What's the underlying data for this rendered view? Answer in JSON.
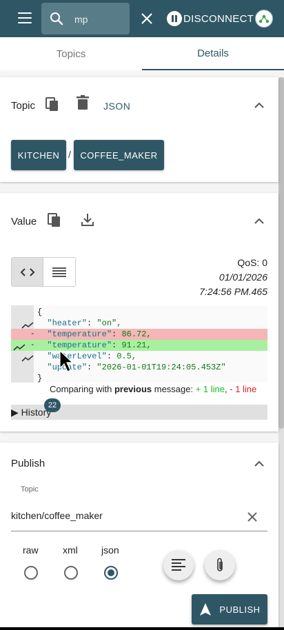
{
  "search": {
    "value": "mp"
  },
  "connection": {
    "label": "DISCONNECT"
  },
  "tabs": [
    {
      "label": "Topics"
    },
    {
      "label": "Details"
    }
  ],
  "topic_section": {
    "title": "Topic",
    "format": "JSON",
    "path": [
      "KITCHEN",
      "COFFEE_MAKER"
    ],
    "separator": "/"
  },
  "value_section": {
    "title": "Value",
    "qos": "QoS: 0",
    "date": "01/01/2026",
    "time": "7:24:56 PM.465",
    "diff_lines": [
      {
        "text": "{",
        "type": "same"
      },
      {
        "key": "\"heater\"",
        "val": "\"on\",",
        "type": "same"
      },
      {
        "key": "\"temperature\"",
        "val": "86.72,",
        "type": "del"
      },
      {
        "key": "\"temperature\"",
        "val": "91.21,",
        "type": "add"
      },
      {
        "key": "\"waterLevel\"",
        "val": "0.5,",
        "type": "same"
      },
      {
        "key": "\"update\"",
        "val": "\"2026-01-01T19:24:05.453Z\"",
        "type": "same"
      },
      {
        "text": "}",
        "type": "same"
      }
    ],
    "compare_prefix": "Comparing with ",
    "compare_bold": "previous",
    "compare_mid": " message: ",
    "compare_plus": "+ 1 line",
    "compare_sep": ", ",
    "compare_minus": "- 1 line",
    "history_label": "History",
    "history_count": "22"
  },
  "publish_section": {
    "title": "Publish",
    "topic_label": "Topic",
    "topic_value": "kitchen/coffee_maker",
    "formats": [
      "raw",
      "xml",
      "json"
    ],
    "selected_format": "json",
    "publish_label": "PUBLISH"
  },
  "colors": {
    "primary": "#2f5664",
    "added": "#a8f0a0",
    "removed": "#f4b6b6"
  }
}
